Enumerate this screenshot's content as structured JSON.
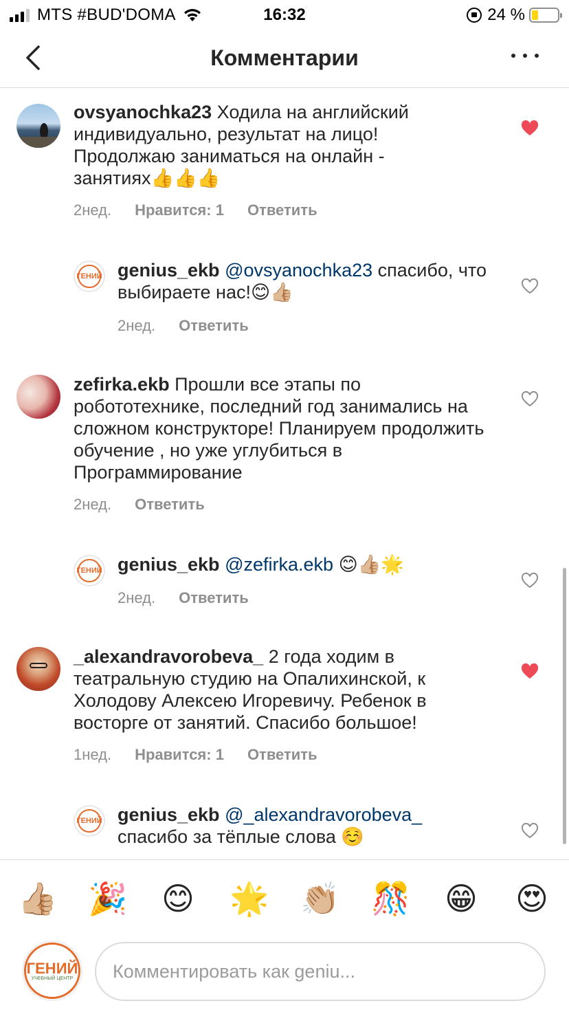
{
  "status_bar": {
    "carrier": "MTS #BUD'DOMA",
    "time": "16:32",
    "battery_percent": "24 %",
    "battery_level": 0.24,
    "icons": [
      "signal-icon",
      "wifi-icon",
      "rotation-lock-icon",
      "battery-icon"
    ]
  },
  "header": {
    "title": "Комментарии",
    "back_icon": "chevron-left-icon",
    "more_icon": "more-icon"
  },
  "comments": [
    {
      "username": "ovsyanochka23",
      "mention": "",
      "text": "Ходила на английский индивидуально, результат на лицо! Продолжаю заниматься на онлайн - занятиях👍👍👍",
      "time": "2нед.",
      "likes": "Нравится: 1",
      "reply": "Ответить",
      "liked": true
    },
    {
      "username": "genius_ekb",
      "mention": "@ovsyanochka23",
      "text": "спасибо, что выбираете нас!😊👍🏼",
      "time": "2нед.",
      "likes": "",
      "reply": "Ответить",
      "liked": false
    },
    {
      "username": "zefirka.ekb",
      "mention": "",
      "text": "Прошли все этапы по робототехнике, последний год занимались на сложном конструкторе! Планируем продолжить обучение , но уже углубиться в Программирование",
      "time": "2нед.",
      "likes": "",
      "reply": "Ответить",
      "liked": false
    },
    {
      "username": "genius_ekb",
      "mention": "@zefirka.ekb",
      "text": "😊👍🏼🌟",
      "time": "2нед.",
      "likes": "",
      "reply": "Ответить",
      "liked": false
    },
    {
      "username": "_alexandravorobeva_",
      "mention": "",
      "text": "2 года ходим в театральную студию на Опалихинской, к Холодову Алексею Игоревичу. Ребенок в восторге от занятий. Спасибо большое!",
      "time": "1нед.",
      "likes": "Нравится: 1",
      "reply": "Ответить",
      "liked": true
    },
    {
      "username": "genius_ekb",
      "mention": "@_alexandravorobeva_",
      "text": "спасибо за тёплые слова ☺️",
      "time": "",
      "likes": "",
      "reply": "",
      "liked": false
    }
  ],
  "avatar_logo_text": "ГЕНИЙ",
  "avatar_logo_subtext": "УЧЕБНЫЙ ЦЕНТР",
  "emoji_bar": [
    "👍🏼",
    "🎉",
    "😊",
    "🌟",
    "👏🏼",
    "🎊",
    "😁",
    "😍"
  ],
  "comment_input": {
    "placeholder": "Комментировать как geniu..."
  },
  "colors": {
    "heart_liked": "#ed4956",
    "mention": "#00376b",
    "secondary_text": "#8e8e8e",
    "logo_accent": "#e36b2b"
  }
}
